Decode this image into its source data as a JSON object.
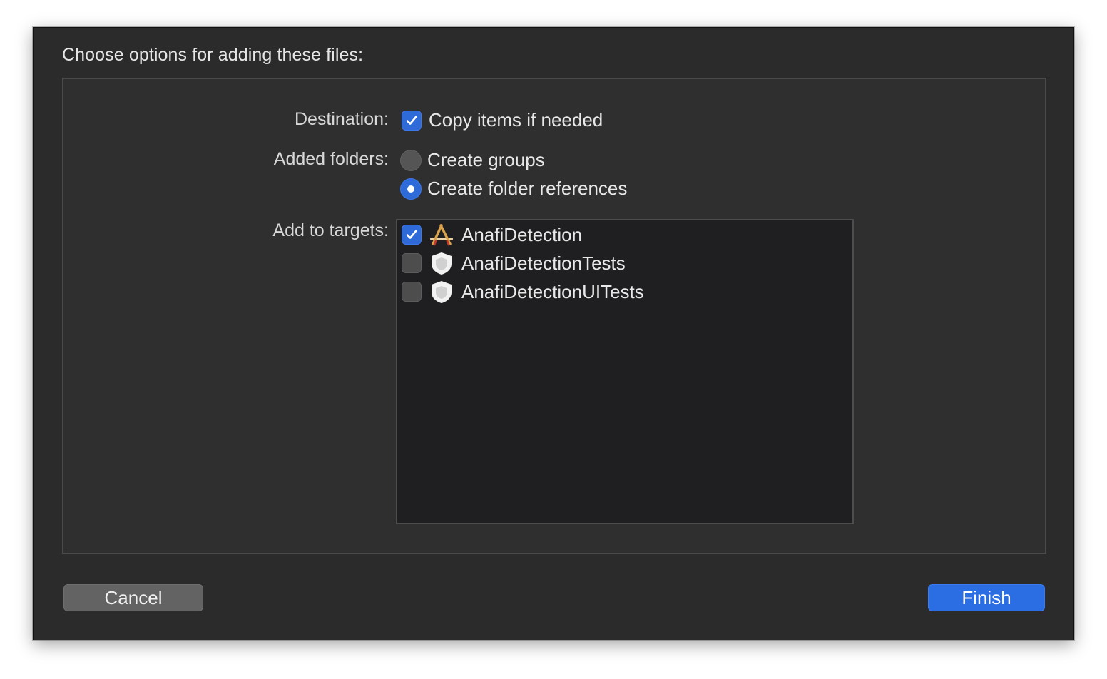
{
  "dialog": {
    "title": "Choose options for adding these files:"
  },
  "destination": {
    "label": "Destination:",
    "option": "Copy items if needed",
    "checked": true
  },
  "added_folders": {
    "label": "Added folders:",
    "options": [
      {
        "label": "Create groups",
        "selected": false
      },
      {
        "label": "Create folder references",
        "selected": true
      }
    ]
  },
  "targets": {
    "label": "Add to targets:",
    "items": [
      {
        "name": "AnafiDetection",
        "checked": true,
        "icon": "app-target-icon"
      },
      {
        "name": "AnafiDetectionTests",
        "checked": false,
        "icon": "test-bundle-icon"
      },
      {
        "name": "AnafiDetectionUITests",
        "checked": false,
        "icon": "test-bundle-icon"
      }
    ]
  },
  "buttons": {
    "cancel": "Cancel",
    "finish": "Finish"
  },
  "colors": {
    "accent": "#2f6ad9",
    "sheet_background": "#2b2b2b",
    "list_background": "#1f1f22"
  }
}
